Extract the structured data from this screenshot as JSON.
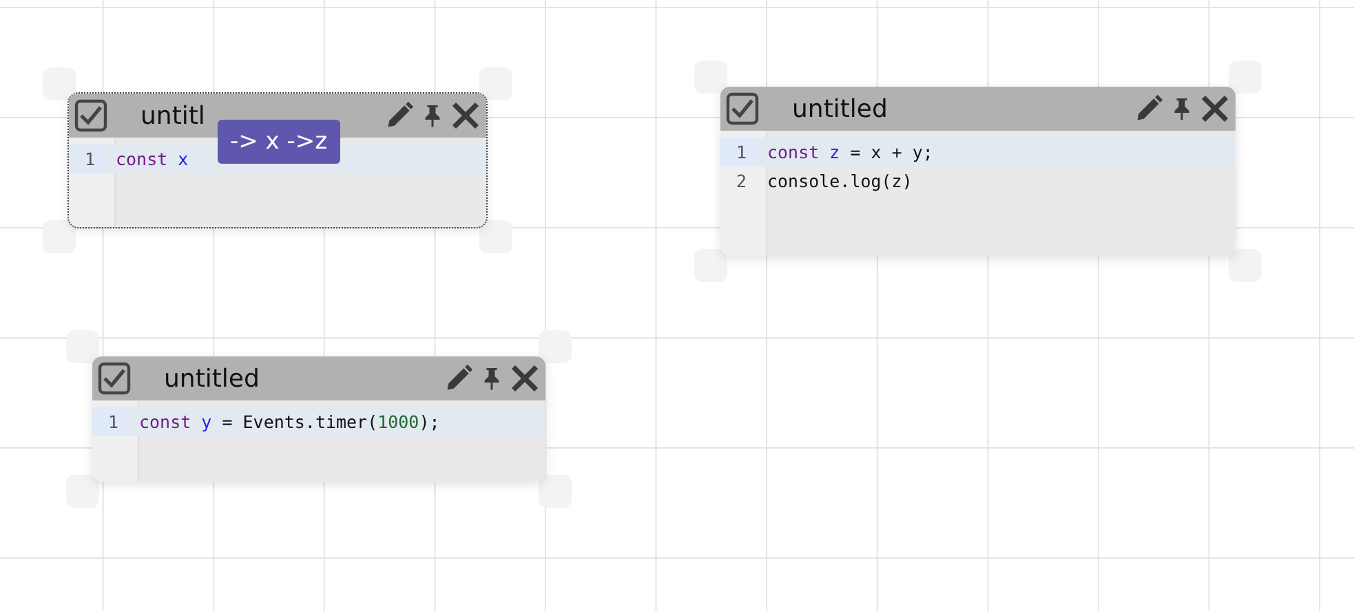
{
  "nodes": [
    {
      "title": "untitl",
      "selected": true,
      "checked": true,
      "lines": [
        {
          "number": "1",
          "active": true,
          "tokens": [
            {
              "kind": "keyword",
              "text": "const"
            },
            {
              "kind": "var",
              "text": "x"
            }
          ]
        }
      ],
      "tooltip": "-> x ->z"
    },
    {
      "title": "untitled",
      "selected": false,
      "checked": true,
      "lines": [
        {
          "number": "1",
          "active": true,
          "tokens": [
            {
              "kind": "keyword",
              "text": "const"
            },
            {
              "kind": "var",
              "text": "z"
            },
            {
              "kind": "plain",
              "text": " = x + y;"
            }
          ]
        },
        {
          "number": "2",
          "active": false,
          "tokens": [
            {
              "kind": "plain",
              "text": "console.log(z)"
            }
          ]
        }
      ]
    },
    {
      "title": "untitled",
      "selected": false,
      "checked": true,
      "lines": [
        {
          "number": "1",
          "active": true,
          "tokens": [
            {
              "kind": "keyword",
              "text": "const"
            },
            {
              "kind": "var",
              "text": "y"
            },
            {
              "kind": "plain",
              "text": " = Events.timer("
            },
            {
              "kind": "number",
              "text": "1000"
            },
            {
              "kind": "plain",
              "text": ");"
            }
          ]
        }
      ]
    }
  ]
}
